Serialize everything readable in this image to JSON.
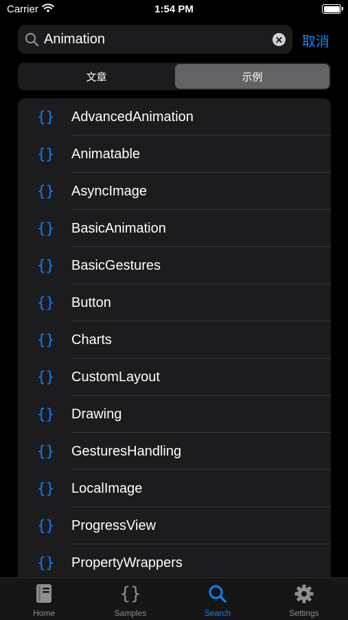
{
  "status": {
    "carrier": "Carrier",
    "time": "1:54 PM"
  },
  "search": {
    "value": "Animation",
    "cancel_label": "取消"
  },
  "segments": [
    {
      "label": "文章",
      "selected": false
    },
    {
      "label": "示例",
      "selected": true
    }
  ],
  "results": {
    "icon": "braces-icon",
    "items": [
      "AdvancedAnimation",
      "Animatable",
      "AsyncImage",
      "BasicAnimation",
      "BasicGestures",
      "Button",
      "Charts",
      "CustomLayout",
      "Drawing",
      "GesturesHandling",
      "LocalImage",
      "ProgressView",
      "PropertyWrappers"
    ]
  },
  "tabbar": {
    "items": [
      {
        "label": "Home",
        "icon": "book-icon",
        "active": false
      },
      {
        "label": "Samples",
        "icon": "braces-icon",
        "active": false
      },
      {
        "label": "Search",
        "icon": "search-icon",
        "active": true
      },
      {
        "label": "Settings",
        "icon": "gear-icon",
        "active": false
      }
    ]
  },
  "colors": {
    "accent": "#0a84ff",
    "background": "#000000",
    "surface": "#1c1c1e",
    "inactive": "#8e8e93"
  }
}
